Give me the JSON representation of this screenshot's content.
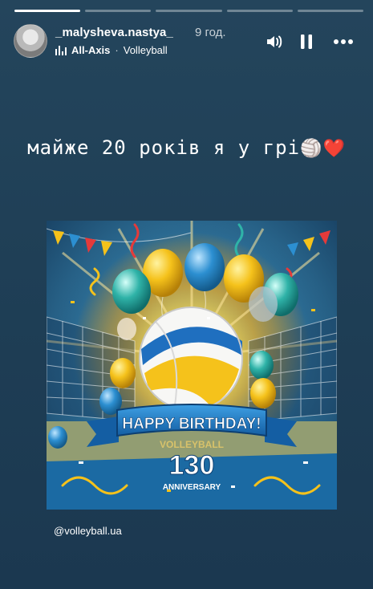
{
  "story": {
    "progress": [
      1,
      0,
      0,
      0,
      0
    ],
    "user": {
      "username": "_malysheva.nastya_",
      "time_ago": "9 год."
    },
    "music": {
      "artist": "All-Axis",
      "separator": "·",
      "track": "Volleyball"
    },
    "caption": {
      "text": "майже 20 років я у грі",
      "emojis": "🏐❤️"
    },
    "mention": "@volleyball.ua",
    "poster": {
      "banner_text": "HAPPY BIRTHDAY!",
      "subtitle": "VOLLEYBALL",
      "number": "130",
      "anniversary": "ANNIVERSARY"
    }
  },
  "icons": [
    "sound-icon",
    "pause-icon",
    "more-icon"
  ],
  "colors": {
    "background": "#1f3f56",
    "yellow": "#f7c51f",
    "blue": "#1c78c1"
  }
}
